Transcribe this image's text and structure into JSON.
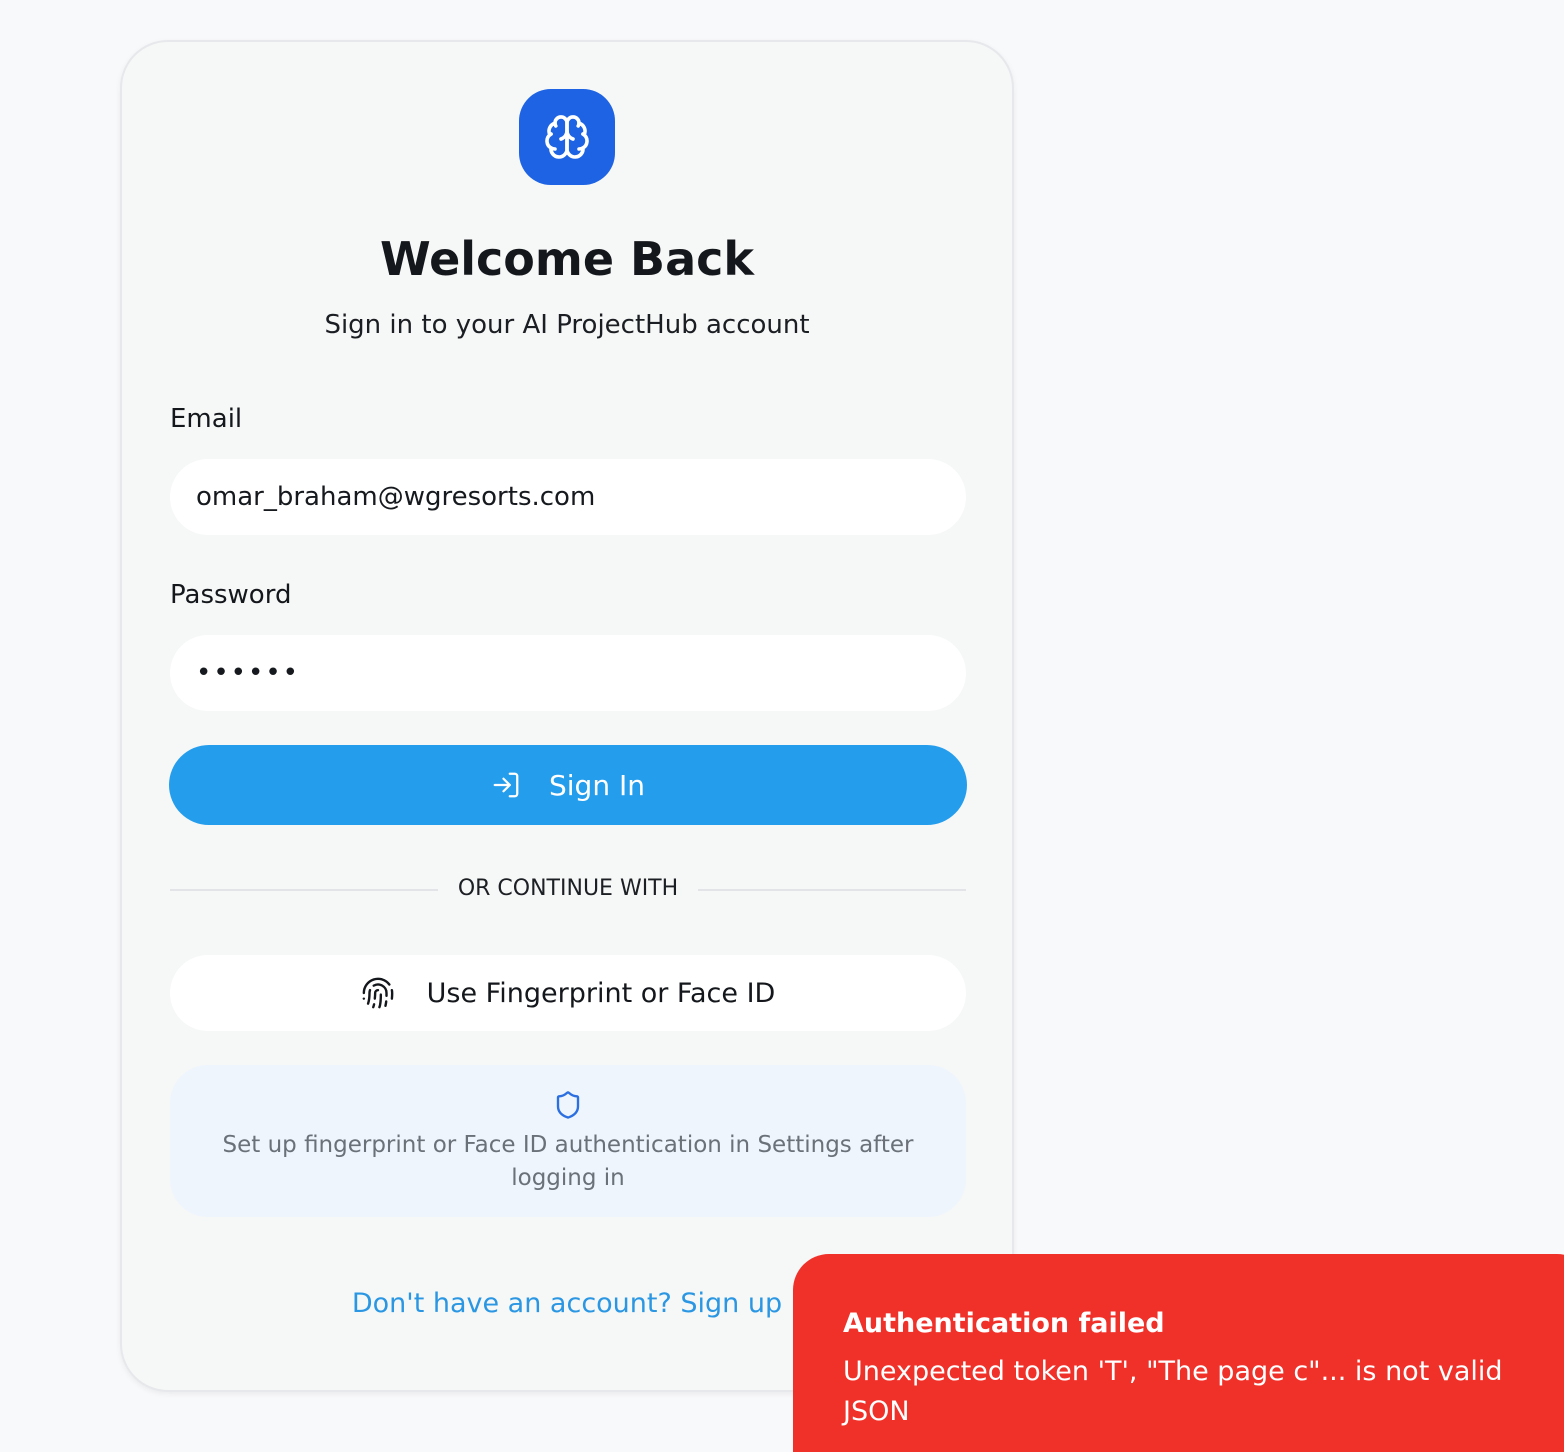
{
  "login": {
    "title": "Welcome Back",
    "subtitle": "Sign in to your AI ProjectHub account",
    "email_label": "Email",
    "email_value": "omar_braham@wgresorts.com",
    "password_label": "Password",
    "password_value": "••••••",
    "signin_label": "Sign In",
    "divider_text": "OR CONTINUE WITH",
    "biometric_label": "Use Fingerprint or Face ID",
    "info_text": "Set up fingerprint or Face ID authentication in Settings after logging in",
    "signup_text": "Don't have an account? Sign up"
  },
  "toast": {
    "title": "Authentication failed",
    "message": "Unexpected token 'T', \"The page c\"... is not valid JSON"
  },
  "icons": {
    "logo": "brain-icon",
    "signin": "log-in-icon",
    "biometric": "fingerprint-icon",
    "info": "shield-icon"
  },
  "colors": {
    "brand": "#1d63e3",
    "primary_button": "#249ded",
    "link": "#2b97e3",
    "error": "#f03129",
    "info_bg": "#eef5fd"
  }
}
